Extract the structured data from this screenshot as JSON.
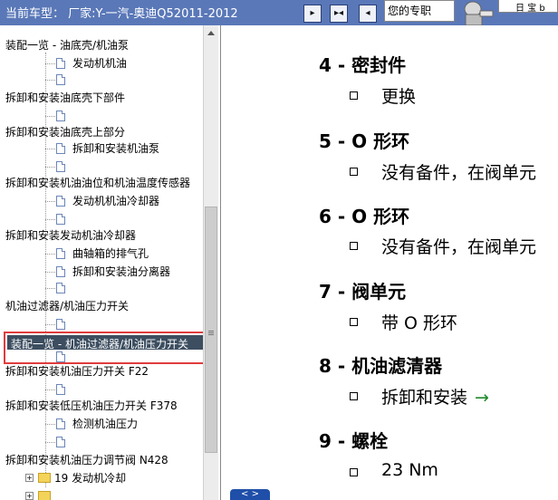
{
  "header": {
    "vehicle_label": "当前车型：  厂家:Y-一汽-奥迪Q52011-2012",
    "user_box": "您的专职",
    "nav_buttons": [
      {
        "icon": "next-arrow-icon",
        "symbol": "▸"
      },
      {
        "icon": "skip-double-arrow-icon",
        "symbol": "▸◂"
      },
      {
        "icon": "prev-arrow-icon",
        "symbol": "◂"
      }
    ],
    "corner_text": "日 宝 b"
  },
  "tree": {
    "rows": [
      {
        "label": "装配一览 - 油底壳/机油泵",
        "type": "text"
      },
      {
        "label": "发动机机油",
        "type": "doc"
      },
      {
        "label": "",
        "type": "doc"
      },
      {
        "label": "拆卸和安装油底壳下部件",
        "type": "text"
      },
      {
        "label": "",
        "type": "doc"
      },
      {
        "label": "拆卸和安装油底壳上部分",
        "type": "text"
      },
      {
        "label": "拆卸和安装机油泵",
        "type": "doc"
      },
      {
        "label": "",
        "type": "doc"
      },
      {
        "label": "拆卸和安装机油油位和机油温度传感器",
        "type": "text"
      },
      {
        "label": "发动机机油冷却器",
        "type": "doc"
      },
      {
        "label": "",
        "type": "doc"
      },
      {
        "label": "拆卸和安装发动机油冷却器",
        "type": "text"
      },
      {
        "label": "曲轴箱的排气孔",
        "type": "doc"
      },
      {
        "label": "拆卸和安装油分离器",
        "type": "doc"
      },
      {
        "label": "",
        "type": "doc"
      },
      {
        "label": "机油过滤器/机油压力开关",
        "type": "text"
      },
      {
        "label": "",
        "type": "doc"
      },
      {
        "label": "拆卸和安装机油压力开关 F22",
        "type": "text"
      },
      {
        "label": "",
        "type": "doc"
      },
      {
        "label": "拆卸和安装低压机油压力开关 F378",
        "type": "text"
      },
      {
        "label": "检测机油压力",
        "type": "doc"
      },
      {
        "label": "",
        "type": "doc"
      },
      {
        "label": "拆卸和安装机油压力调节阀 N428",
        "type": "text"
      },
      {
        "label": "19 发动机冷却",
        "type": "folder"
      }
    ],
    "selected_label": "装配一览 - 机油过滤器/机油压力开关"
  },
  "content": {
    "items": [
      {
        "heading": "4 - 密封件",
        "detail": "更换",
        "arrow": ""
      },
      {
        "heading": "5 - O 形环",
        "detail": "没有备件，在阀单元",
        "arrow": ""
      },
      {
        "heading": "6 - O 形环",
        "detail": "没有备件，在阀单元",
        "arrow": ""
      },
      {
        "heading": "7 - 阀单元",
        "detail": "带 O 形环",
        "arrow": ""
      },
      {
        "heading": "8 - 机油滤清器",
        "detail": "拆卸和安装",
        "arrow": "→"
      },
      {
        "heading": "9 - 螺栓",
        "detail": "23 Nm",
        "arrow": ""
      }
    ],
    "bottom_tab": "< >"
  },
  "colors": {
    "header_bg": "#5a78b8",
    "selected_bg": "#3c4e60",
    "highlight_border": "#e03c3c",
    "arrow_green": "#1f8a2b"
  }
}
